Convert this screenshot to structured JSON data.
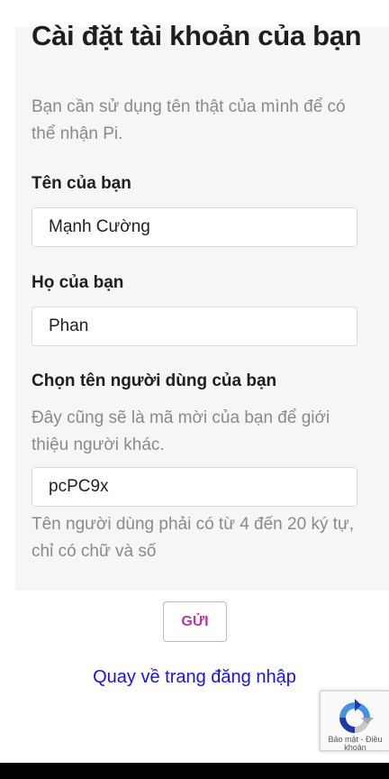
{
  "page": {
    "title": "Cài đặt tài khoản của bạn",
    "intro": "Bạn cần sử dụng tên thật của mình để có thể nhận Pi."
  },
  "form": {
    "first_name": {
      "label": "Tên của bạn",
      "value": "Mạnh Cường"
    },
    "last_name": {
      "label": "Họ của bạn",
      "value": "Phan"
    },
    "username": {
      "label": "Chọn tên người dùng của bạn",
      "description": "Đây cũng sẽ là mã mời của bạn để giới thiệu người khác.",
      "value": "pcPC9x",
      "hint": "Tên người dùng phải có từ 4 đến 20 ký tự, chỉ có chữ và số"
    },
    "submit_label": "GỬI"
  },
  "back_link": "Quay về trang đăng nhập",
  "recaptcha": {
    "terms": "Bảo mật - Điều khoản"
  },
  "colors": {
    "accent": "#b13a9e",
    "link": "#1a12e0",
    "panel": "#f6f6f6",
    "muted_text": "#8a8a8a"
  }
}
